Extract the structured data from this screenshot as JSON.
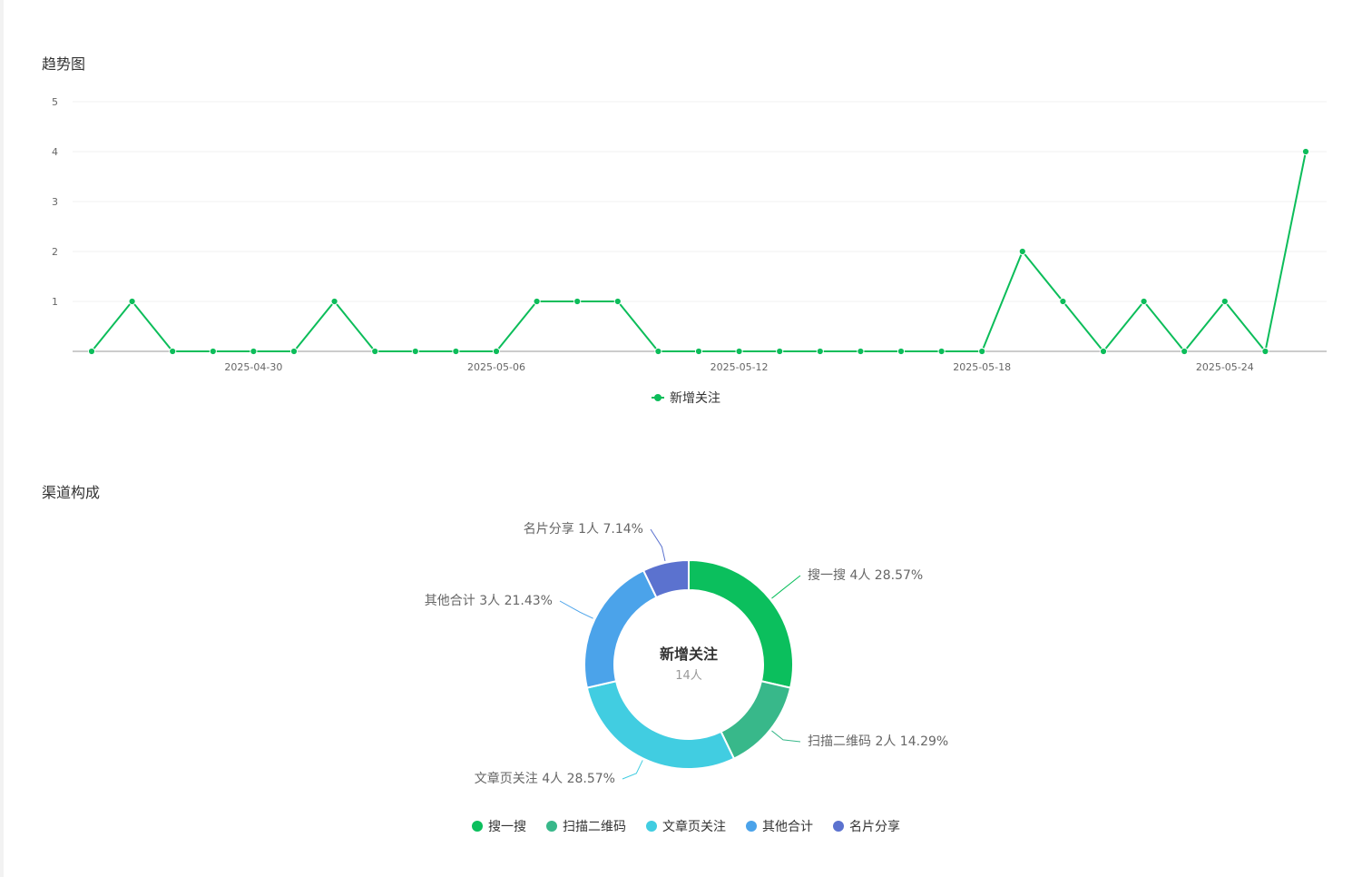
{
  "sections": {
    "trend_title": "趋势图",
    "channel_title": "渠道构成"
  },
  "colors": {
    "line": "#0cbd5a",
    "grid": "#f0f0f0",
    "axis": "#cccccc"
  },
  "chart_data": [
    {
      "type": "line",
      "title": "",
      "series": [
        {
          "name": "新增关注",
          "color": "#0cbd5a",
          "x": [
            "2025-04-26",
            "2025-04-27",
            "2025-04-28",
            "2025-04-29",
            "2025-04-30",
            "2025-05-01",
            "2025-05-02",
            "2025-05-03",
            "2025-05-04",
            "2025-05-05",
            "2025-05-06",
            "2025-05-07",
            "2025-05-08",
            "2025-05-09",
            "2025-05-10",
            "2025-05-11",
            "2025-05-12",
            "2025-05-13",
            "2025-05-14",
            "2025-05-15",
            "2025-05-16",
            "2025-05-17",
            "2025-05-18",
            "2025-05-19",
            "2025-05-20",
            "2025-05-21",
            "2025-05-22",
            "2025-05-23",
            "2025-05-24",
            "2025-05-25",
            "2025-05-26"
          ],
          "values": [
            0,
            1,
            0,
            0,
            0,
            0,
            1,
            0,
            0,
            0,
            0,
            1,
            1,
            1,
            0,
            0,
            0,
            0,
            0,
            0,
            0,
            0,
            0,
            2,
            1,
            0,
            1,
            0,
            1,
            0,
            4
          ]
        }
      ],
      "x_tick_labels": [
        "2025-04-30",
        "2025-05-06",
        "2025-05-12",
        "2025-05-18",
        "2025-05-24"
      ],
      "y_tick_labels": [
        "1",
        "2",
        "3",
        "4",
        "5"
      ],
      "ylim": [
        0,
        5
      ],
      "grid": true,
      "legend": "bottom-center"
    },
    {
      "type": "pie",
      "donut": true,
      "center_title": "新增关注",
      "center_value": "14人",
      "slices": [
        {
          "name": "搜一搜",
          "value": 4,
          "label": "搜一搜 4人 28.57%",
          "color": "#0bbf5d"
        },
        {
          "name": "扫描二维码",
          "value": 2,
          "label": "扫描二维码 2人 14.29%",
          "color": "#38b88a"
        },
        {
          "name": "文章页关注",
          "value": 4,
          "label": "文章页关注 4人 28.57%",
          "color": "#41cde1"
        },
        {
          "name": "其他合计",
          "value": 3,
          "label": "其他合计 3人 21.43%",
          "color": "#4ba3ea"
        },
        {
          "name": "名片分享",
          "value": 1,
          "label": "名片分享 1人 7.14%",
          "color": "#5b72cf"
        }
      ],
      "legend": "bottom-center"
    }
  ]
}
